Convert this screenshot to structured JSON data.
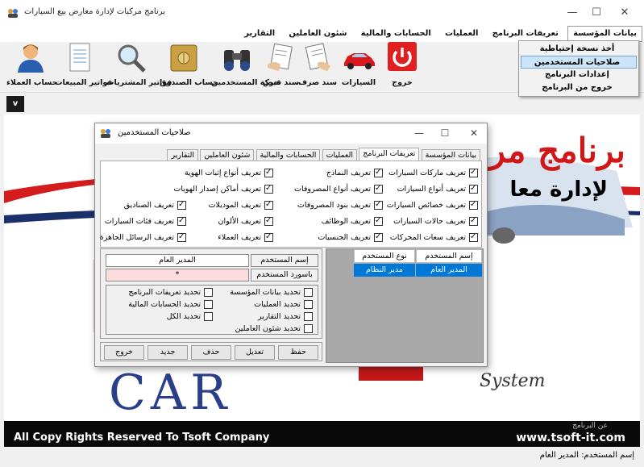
{
  "window": {
    "title": "برنامج مركبات لإدارة معارض بيع السيارات",
    "minimize": "—",
    "maximize": "☐",
    "close": "✕"
  },
  "menu": {
    "items": [
      "بيانات المؤسسة",
      "تعريفات البرنامج",
      "العمليات",
      "الحسابات والمالية",
      "شئون العاملين",
      "التقارير"
    ]
  },
  "dropdown": {
    "items": [
      "أخذ نسخة إحتياطية",
      "صلاحيات المستخدمين",
      "إعدادات البرنامج",
      "خروج من البرنامج"
    ]
  },
  "toolbar": {
    "exit": "خروج",
    "cars": "السيارات",
    "payment": "سند صرف",
    "receipt": "سند قبض",
    "users_activity": "حركة المستخدمين",
    "cash_box": "حساب الصندوق",
    "purchase_invoices": "فواتير المشتريات",
    "sales_invoices": "فواتير المبيعات",
    "customer_account": "حساب العملاء"
  },
  "small_button": "v",
  "background": {
    "title": "برنامج مر",
    "subtitle": "لإدارة معا",
    "system": "System",
    "car": "CAR"
  },
  "footer": {
    "copyright": "All Copy Rights Reserved To Tsoft Company",
    "website": "www.tsoft-it.com",
    "about": "عن البرنامج"
  },
  "status": {
    "label": "إسم المستخدم:",
    "value": "المدير العام"
  },
  "dialog": {
    "title": "صلاحيات المستخدمين",
    "minimize": "—",
    "maximize": "☐",
    "close": "✕",
    "tabs": [
      "بيانات المؤسسة",
      "تعريفات البرنامج",
      "العمليات",
      "الحسابات والمالية",
      "شئون العاملين",
      "التقارير"
    ],
    "permissions": [
      "تعريف ماركات السيارات",
      "تعريف النماذج",
      "تعريف أنواع إثبات الهوية",
      "تعريف أنواع السيارات",
      "تعريف أنواع المصروفات",
      "تعريف أماكن إصدار الهويات",
      "تعريف خصائص السيارات",
      "تعريف بنود المصروفات",
      "تعريف الموديلات",
      "تعريف الصناديق",
      "تعريف حالات السيارات",
      "تعريف الوظائف",
      "تعريف الألوان",
      "تعريف فئات السيارات",
      "تعريف سعات المحركات",
      "تعريف الجنسيات",
      "تعريف العملاء",
      "تعريف الرسائل الجاهزة"
    ],
    "username_label": "إسم المستخدم",
    "username_value": "المدير العام",
    "password_label": "باسورد المستخدم",
    "password_value": "*",
    "options": [
      "تحديد بيانات المؤسسة",
      "تحديد تعريفات البرنامج",
      "تحديد العمليات",
      "تحديد الحسابات المالية",
      "تحديد التقارير",
      "تحديد الكل",
      "تحديد شئون العاملين"
    ],
    "buttons": {
      "save": "حفظ",
      "edit": "تعديل",
      "delete": "حذف",
      "new": "جديد",
      "exit": "خروج"
    },
    "grid": {
      "headers": [
        "إسم المستخدم",
        "نوع المستخدم"
      ],
      "rows": [
        [
          "المدير العام",
          "مدير النظام"
        ]
      ]
    }
  }
}
